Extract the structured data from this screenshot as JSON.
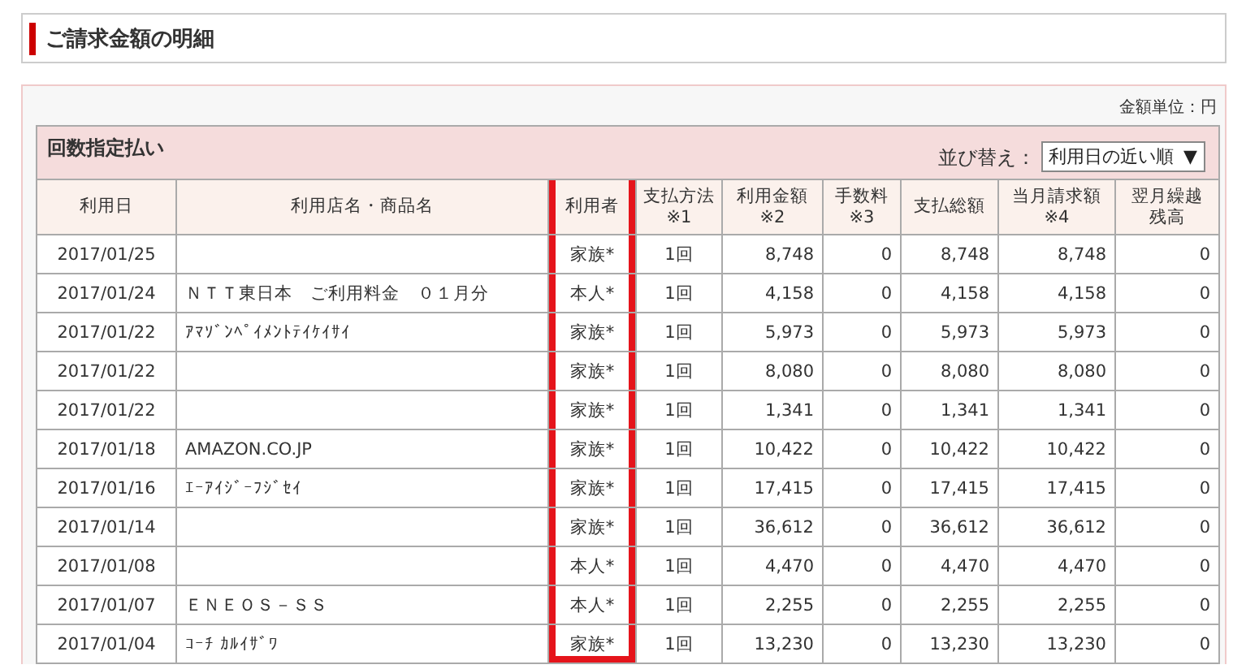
{
  "page_title": "ご請求金額の明細",
  "unit_note": "金額単位：円",
  "section": {
    "title": "回数指定払い",
    "sort_label": "並び替え：",
    "sort_value": "利用日の近い順",
    "sort_caret": "▼"
  },
  "table": {
    "columns": [
      {
        "label_lines": [
          "利用日"
        ],
        "highlighted": false
      },
      {
        "label_lines": [
          "利用店名・商品名"
        ],
        "highlighted": false
      },
      {
        "label_lines": [
          "利用者"
        ],
        "highlighted": true
      },
      {
        "label_lines": [
          "支払方法",
          "※1"
        ],
        "highlighted": false
      },
      {
        "label_lines": [
          "利用金額",
          "※2"
        ],
        "highlighted": false
      },
      {
        "label_lines": [
          "手数料",
          "※3"
        ],
        "highlighted": false
      },
      {
        "label_lines": [
          "支払総額"
        ],
        "highlighted": false
      },
      {
        "label_lines": [
          "当月請求額",
          "※4"
        ],
        "highlighted": false
      },
      {
        "label_lines": [
          "翌月繰越",
          "残高"
        ],
        "highlighted": false
      }
    ],
    "rows": [
      [
        "2017/01/25",
        "",
        "家族*",
        "1回",
        "8,748",
        "0",
        "8,748",
        "8,748",
        "0"
      ],
      [
        "2017/01/24",
        "ＮＴＴ東日本　ご利用料金　０１月分",
        "本人*",
        "1回",
        "4,158",
        "0",
        "4,158",
        "4,158",
        "0"
      ],
      [
        "2017/01/22",
        "ｱﾏｿﾞﾝﾍﾟｲﾒﾝﾄﾃｲｹｲｻｲ",
        "家族*",
        "1回",
        "5,973",
        "0",
        "5,973",
        "5,973",
        "0"
      ],
      [
        "2017/01/22",
        "",
        "家族*",
        "1回",
        "8,080",
        "0",
        "8,080",
        "8,080",
        "0"
      ],
      [
        "2017/01/22",
        "",
        "家族*",
        "1回",
        "1,341",
        "0",
        "1,341",
        "1,341",
        "0"
      ],
      [
        "2017/01/18",
        "AMAZON.CO.JP",
        "家族*",
        "1回",
        "10,422",
        "0",
        "10,422",
        "10,422",
        "0"
      ],
      [
        "2017/01/16",
        "ｴｰｱｲｼﾞｰﾌｼﾞｾｲ",
        "家族*",
        "1回",
        "17,415",
        "0",
        "17,415",
        "17,415",
        "0"
      ],
      [
        "2017/01/14",
        "",
        "家族*",
        "1回",
        "36,612",
        "0",
        "36,612",
        "36,612",
        "0"
      ],
      [
        "2017/01/08",
        "",
        "本人*",
        "1回",
        "4,470",
        "0",
        "4,470",
        "4,470",
        "0"
      ],
      [
        "2017/01/07",
        "ＥＮＥＯＳ－ＳＳ",
        "本人*",
        "1回",
        "2,255",
        "0",
        "2,255",
        "2,255",
        "0"
      ],
      [
        "2017/01/04",
        "ｺｰﾁ ｶﾙｲｻﾞﾜ",
        "家族*",
        "1回",
        "13,230",
        "0",
        "13,230",
        "13,230",
        "0"
      ]
    ]
  }
}
